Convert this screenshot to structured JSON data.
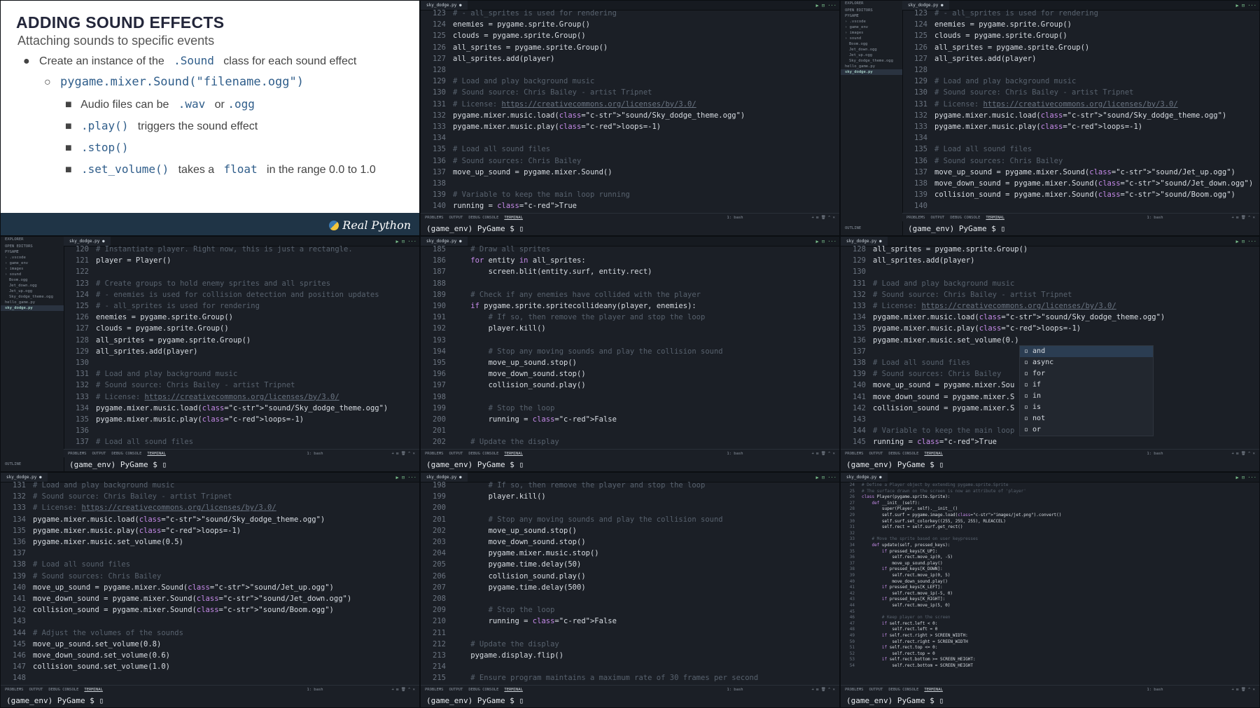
{
  "slide": {
    "title": "ADDING SOUND EFFECTS",
    "subtitle": "Attaching sounds to specific events",
    "b1_pre": "Create an instance of the",
    "b1_code": ".Sound",
    "b1_post": "class for each sound effect",
    "b2_code": "pygame.mixer.Sound(\"filename.ogg\")",
    "b3_pre": "Audio files can be",
    "b3_wav": ".wav",
    "b3_or": "or",
    "b3_ogg": ".ogg",
    "b4_code": ".play()",
    "b4_post": "triggers the sound effect",
    "b5_code": ".stop()",
    "b6_code": ".set_volume()",
    "b6_mid": "takes a",
    "b6_float": "float",
    "b6_post": "in the range 0.0 to 1.0",
    "logo": "Real Python"
  },
  "terminal": {
    "tabs": [
      "PROBLEMS",
      "OUTPUT",
      "DEBUG CONSOLE",
      "TERMINAL"
    ],
    "shell": "1: bash",
    "prompt": "(game_env) PyGame $ "
  },
  "tab_file": "sky_dodge.py",
  "explorer": {
    "heading": "EXPLORER",
    "open_editors": "OPEN EDITORS",
    "project": "PYGAME",
    "items": [
      ".vscode",
      "game_env",
      "images",
      "sound",
      "Boom.ogg",
      "Jet_down.ogg",
      "Jet_up.ogg",
      "Sky_dodge_theme.ogg",
      "hello_game.py",
      "sky_dodge.py"
    ],
    "outline": "OUTLINE"
  },
  "panel2": {
    "start": 123,
    "lines": [
      "# - all_sprites is used for rendering",
      "enemies = pygame.sprite.Group()",
      "clouds = pygame.sprite.Group()",
      "all_sprites = pygame.sprite.Group()",
      "all_sprites.add(player)",
      "",
      "# Load and play background music",
      "# Sound source: Chris Bailey - artist Tripnet",
      "# License: https://creativecommons.org/licenses/by/3.0/",
      "pygame.mixer.music.load(\"sound/Sky_dodge_theme.ogg\")",
      "pygame.mixer.music.play(loops=-1)",
      "",
      "# Load all sound files",
      "# Sound sources: Chris Bailey",
      "move_up_sound = pygame.mixer.Sound()",
      "",
      "# Variable to keep the main loop running",
      "running = True"
    ]
  },
  "panel3": {
    "start": 123,
    "lines": [
      "# - all_sprites is used for rendering",
      "enemies = pygame.sprite.Group()",
      "clouds = pygame.sprite.Group()",
      "all_sprites = pygame.sprite.Group()",
      "all_sprites.add(player)",
      "",
      "# Load and play background music",
      "# Sound source: Chris Bailey - artist Tripnet",
      "# License: https://creativecommons.org/licenses/by/3.0/",
      "pygame.mixer.music.load(\"sound/Sky_dodge_theme.ogg\")",
      "pygame.mixer.music.play(loops=-1)",
      "",
      "# Load all sound files",
      "# Sound sources: Chris Bailey",
      "move_up_sound = pygame.mixer.Sound(\"sound/Jet_up.ogg\")",
      "move_down_sound = pygame.mixer.Sound(\"sound/Jet_down.ogg\")",
      "collision_sound = pygame.mixer.Sound(\"sound/Boom.ogg\")",
      ""
    ]
  },
  "panel4": {
    "start": 120,
    "lines": [
      "# Instantiate player. Right now, this is just a rectangle.",
      "player = Player()",
      "",
      "# Create groups to hold enemy sprites and all sprites",
      "# - enemies is used for collision detection and position updates",
      "# - all_sprites is used for rendering",
      "enemies = pygame.sprite.Group()",
      "clouds = pygame.sprite.Group()",
      "all_sprites = pygame.sprite.Group()",
      "all_sprites.add(player)",
      "",
      "# Load and play background music",
      "# Sound source: Chris Bailey - artist Tripnet",
      "# License: https://creativecommons.org/licenses/by/3.0/",
      "pygame.mixer.music.load(\"sound/Sky_dodge_theme.ogg\")",
      "pygame.mixer.music.play(loops=-1)",
      "",
      "# Load all sound files"
    ]
  },
  "panel5": {
    "start": 185,
    "lines": [
      "    # Draw all sprites",
      "    for entity in all_sprites:",
      "        screen.blit(entity.surf, entity.rect)",
      "",
      "    # Check if any enemies have collided with the player",
      "    if pygame.sprite.spritecollideany(player, enemies):",
      "        # If so, then remove the player and stop the loop",
      "        player.kill()",
      "",
      "        # Stop any moving sounds and play the collision sound",
      "        move_up_sound.stop()",
      "        move_down_sound.stop()",
      "        collision_sound.play()",
      "",
      "        # Stop the loop",
      "        running = False",
      "",
      "    # Update the display"
    ]
  },
  "panel6": {
    "start": 128,
    "lines": [
      "all_sprites = pygame.sprite.Group()",
      "all_sprites.add(player)",
      "",
      "# Load and play background music",
      "# Sound source: Chris Bailey - artist Tripnet",
      "# License: https://creativecommons.org/licenses/by/3.0/",
      "pygame.mixer.music.load(\"sound/Sky_dodge_theme.ogg\")",
      "pygame.mixer.music.play(loops=-1)",
      "pygame.mixer.music.set_volume(0.)",
      "",
      "# Load all sound files",
      "# Sound sources: Chris Bailey",
      "move_up_sound = pygame.mixer.Sou",
      "move_down_sound = pygame.mixer.S",
      "collision_sound = pygame.mixer.S",
      "",
      "# Variable to keep the main loop",
      "running = True"
    ],
    "suggestions": [
      "and",
      "async",
      "for",
      "if",
      "in",
      "is",
      "not",
      "or"
    ]
  },
  "panel7": {
    "start": 131,
    "lines": [
      "# Load and play background music",
      "# Sound source: Chris Bailey - artist Tripnet",
      "# License: https://creativecommons.org/licenses/by/3.0/",
      "pygame.mixer.music.load(\"sound/Sky_dodge_theme.ogg\")",
      "pygame.mixer.music.play(loops=-1)",
      "pygame.mixer.music.set_volume(0.5)",
      "",
      "# Load all sound files",
      "# Sound sources: Chris Bailey",
      "move_up_sound = pygame.mixer.Sound(\"sound/Jet_up.ogg\")",
      "move_down_sound = pygame.mixer.Sound(\"sound/Jet_down.ogg\")",
      "collision_sound = pygame.mixer.Sound(\"sound/Boom.ogg\")",
      "",
      "# Adjust the volumes of the sounds",
      "move_up_sound.set_volume(0.8)",
      "move_down_sound.set_volume(0.6)",
      "collision_sound.set_volume(1.0)",
      ""
    ]
  },
  "panel8": {
    "start": 198,
    "lines": [
      "        # If so, then remove the player and stop the loop",
      "        player.kill()",
      "",
      "        # Stop any moving sounds and play the collision sound",
      "        move_up_sound.stop()",
      "        move_down_sound.stop()",
      "        pygame.mixer.music.stop()",
      "        pygame.time.delay(50)",
      "        collision_sound.play()",
      "        pygame.time.delay(500)",
      "",
      "        # Stop the loop",
      "        running = False",
      "",
      "    # Update the display",
      "    pygame.display.flip()",
      "",
      "    # Ensure program maintains a maximum rate of 30 frames per second"
    ]
  },
  "panel9": {
    "start": 24,
    "lines": [
      "# Define a Player object by extending pygame.sprite.Sprite",
      "# The surface drawn on the screen is now an attribute of 'player'",
      "class Player(pygame.sprite.Sprite):",
      "    def __init__(self):",
      "        super(Player, self).__init__()",
      "        self.surf = pygame.image.load(\"images/jet.png\").convert()",
      "        self.surf.set_colorkey((255, 255, 255), RLEACCEL)",
      "        self.rect = self.surf.get_rect()",
      "",
      "    # Move the sprite based on user keypresses",
      "    def update(self, pressed_keys):",
      "        if pressed_keys[K_UP]:",
      "            self.rect.move_ip(0, -5)",
      "            move_up_sound.play()",
      "        if pressed_keys[K_DOWN]:",
      "            self.rect.move_ip(0, 5)",
      "            move_down_sound.play()",
      "        if pressed_keys[K_LEFT]:",
      "            self.rect.move_ip(-5, 0)",
      "        if pressed_keys[K_RIGHT]:",
      "            self.rect.move_ip(5, 0)",
      "",
      "        # Keep player on the screen",
      "        if self.rect.left < 0:",
      "            self.rect.left = 0",
      "        if self.rect.right > SCREEN_WIDTH:",
      "            self.rect.right = SCREEN_WIDTH",
      "        if self.rect.top <= 0:",
      "            self.rect.top = 0",
      "        if self.rect.bottom >= SCREEN_HEIGHT:",
      "            self.rect.bottom = SCREEN_HEIGHT"
    ]
  }
}
